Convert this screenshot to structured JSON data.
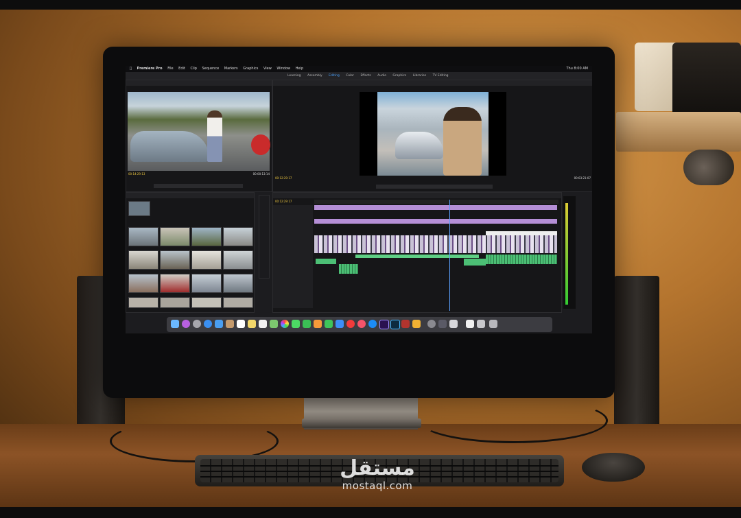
{
  "scene": {
    "subject": "desktop-monitor-video-editing",
    "colors": {
      "wall": "#b4742e",
      "desk": "#8c5326",
      "bezel": "#0c0c0d",
      "accent": "#4aa3ff",
      "timecode": "#f0c940"
    }
  },
  "app": {
    "menubar": [
      "Premiere Pro",
      "File",
      "Edit",
      "Clip",
      "Sequence",
      "Markers",
      "Graphics",
      "View",
      "Window",
      "Help"
    ],
    "clock": "Thu 8:00 AM",
    "workspaces": [
      "Learning",
      "Assembly",
      "Editing",
      "Color",
      "Effects",
      "Audio",
      "Graphics",
      "Libraries",
      "TV Editing"
    ],
    "active_workspace": "Editing"
  },
  "source_monitor": {
    "timecode_in": "00:14:29:13",
    "timecode_out": "00:00:13:14"
  },
  "program_monitor": {
    "timecode_in": "00:12:29:17",
    "timecode_out": "00:03:21:07"
  },
  "timeline": {
    "timecode": "00:12:29:17"
  },
  "watermark": {
    "arabic": "مستقل",
    "latin": "mostaql.com"
  }
}
